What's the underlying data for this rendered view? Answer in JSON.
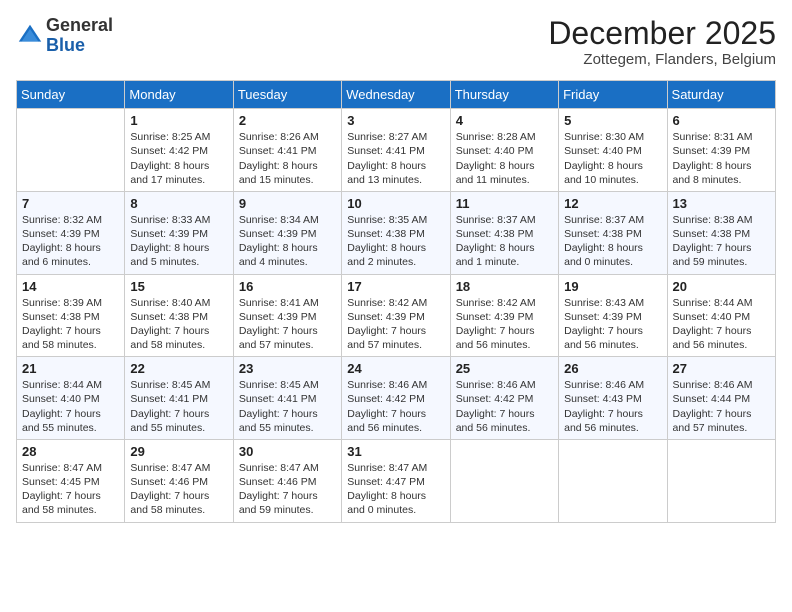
{
  "header": {
    "logo_general": "General",
    "logo_blue": "Blue",
    "month_year": "December 2025",
    "location": "Zottegem, Flanders, Belgium"
  },
  "days_of_week": [
    "Sunday",
    "Monday",
    "Tuesday",
    "Wednesday",
    "Thursday",
    "Friday",
    "Saturday"
  ],
  "weeks": [
    [
      {
        "day": "",
        "info": ""
      },
      {
        "day": "1",
        "info": "Sunrise: 8:25 AM\nSunset: 4:42 PM\nDaylight: 8 hours\nand 17 minutes."
      },
      {
        "day": "2",
        "info": "Sunrise: 8:26 AM\nSunset: 4:41 PM\nDaylight: 8 hours\nand 15 minutes."
      },
      {
        "day": "3",
        "info": "Sunrise: 8:27 AM\nSunset: 4:41 PM\nDaylight: 8 hours\nand 13 minutes."
      },
      {
        "day": "4",
        "info": "Sunrise: 8:28 AM\nSunset: 4:40 PM\nDaylight: 8 hours\nand 11 minutes."
      },
      {
        "day": "5",
        "info": "Sunrise: 8:30 AM\nSunset: 4:40 PM\nDaylight: 8 hours\nand 10 minutes."
      },
      {
        "day": "6",
        "info": "Sunrise: 8:31 AM\nSunset: 4:39 PM\nDaylight: 8 hours\nand 8 minutes."
      }
    ],
    [
      {
        "day": "7",
        "info": "Sunrise: 8:32 AM\nSunset: 4:39 PM\nDaylight: 8 hours\nand 6 minutes."
      },
      {
        "day": "8",
        "info": "Sunrise: 8:33 AM\nSunset: 4:39 PM\nDaylight: 8 hours\nand 5 minutes."
      },
      {
        "day": "9",
        "info": "Sunrise: 8:34 AM\nSunset: 4:39 PM\nDaylight: 8 hours\nand 4 minutes."
      },
      {
        "day": "10",
        "info": "Sunrise: 8:35 AM\nSunset: 4:38 PM\nDaylight: 8 hours\nand 2 minutes."
      },
      {
        "day": "11",
        "info": "Sunrise: 8:37 AM\nSunset: 4:38 PM\nDaylight: 8 hours\nand 1 minute."
      },
      {
        "day": "12",
        "info": "Sunrise: 8:37 AM\nSunset: 4:38 PM\nDaylight: 8 hours\nand 0 minutes."
      },
      {
        "day": "13",
        "info": "Sunrise: 8:38 AM\nSunset: 4:38 PM\nDaylight: 7 hours\nand 59 minutes."
      }
    ],
    [
      {
        "day": "14",
        "info": "Sunrise: 8:39 AM\nSunset: 4:38 PM\nDaylight: 7 hours\nand 58 minutes."
      },
      {
        "day": "15",
        "info": "Sunrise: 8:40 AM\nSunset: 4:38 PM\nDaylight: 7 hours\nand 58 minutes."
      },
      {
        "day": "16",
        "info": "Sunrise: 8:41 AM\nSunset: 4:39 PM\nDaylight: 7 hours\nand 57 minutes."
      },
      {
        "day": "17",
        "info": "Sunrise: 8:42 AM\nSunset: 4:39 PM\nDaylight: 7 hours\nand 57 minutes."
      },
      {
        "day": "18",
        "info": "Sunrise: 8:42 AM\nSunset: 4:39 PM\nDaylight: 7 hours\nand 56 minutes."
      },
      {
        "day": "19",
        "info": "Sunrise: 8:43 AM\nSunset: 4:39 PM\nDaylight: 7 hours\nand 56 minutes."
      },
      {
        "day": "20",
        "info": "Sunrise: 8:44 AM\nSunset: 4:40 PM\nDaylight: 7 hours\nand 56 minutes."
      }
    ],
    [
      {
        "day": "21",
        "info": "Sunrise: 8:44 AM\nSunset: 4:40 PM\nDaylight: 7 hours\nand 55 minutes."
      },
      {
        "day": "22",
        "info": "Sunrise: 8:45 AM\nSunset: 4:41 PM\nDaylight: 7 hours\nand 55 minutes."
      },
      {
        "day": "23",
        "info": "Sunrise: 8:45 AM\nSunset: 4:41 PM\nDaylight: 7 hours\nand 55 minutes."
      },
      {
        "day": "24",
        "info": "Sunrise: 8:46 AM\nSunset: 4:42 PM\nDaylight: 7 hours\nand 56 minutes."
      },
      {
        "day": "25",
        "info": "Sunrise: 8:46 AM\nSunset: 4:42 PM\nDaylight: 7 hours\nand 56 minutes."
      },
      {
        "day": "26",
        "info": "Sunrise: 8:46 AM\nSunset: 4:43 PM\nDaylight: 7 hours\nand 56 minutes."
      },
      {
        "day": "27",
        "info": "Sunrise: 8:46 AM\nSunset: 4:44 PM\nDaylight: 7 hours\nand 57 minutes."
      }
    ],
    [
      {
        "day": "28",
        "info": "Sunrise: 8:47 AM\nSunset: 4:45 PM\nDaylight: 7 hours\nand 58 minutes."
      },
      {
        "day": "29",
        "info": "Sunrise: 8:47 AM\nSunset: 4:46 PM\nDaylight: 7 hours\nand 58 minutes."
      },
      {
        "day": "30",
        "info": "Sunrise: 8:47 AM\nSunset: 4:46 PM\nDaylight: 7 hours\nand 59 minutes."
      },
      {
        "day": "31",
        "info": "Sunrise: 8:47 AM\nSunset: 4:47 PM\nDaylight: 8 hours\nand 0 minutes."
      },
      {
        "day": "",
        "info": ""
      },
      {
        "day": "",
        "info": ""
      },
      {
        "day": "",
        "info": ""
      }
    ]
  ]
}
